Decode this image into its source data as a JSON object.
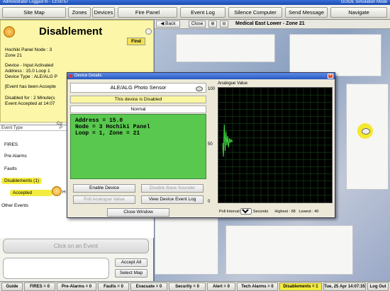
{
  "titlebar": {
    "left": "Administrator Logged In - 13:50:57",
    "right": "GUIDE Simulation Mode"
  },
  "topbar": {
    "buttons": [
      "Site Map",
      "Zones",
      "Devices",
      "Fire Panel",
      "Event Log",
      "Silence Computer",
      "Send Message",
      "Navigate"
    ]
  },
  "event": {
    "title": "Disablement",
    "find": "Find",
    "lines": [
      "Hochiki Panel  Node : 3",
      "Zone 21",
      "Device - Input Activated",
      "Address : 15.0  Loop 1",
      "Device Type : ALE/ALG P",
      "[Event has been Accepte",
      "Disabled for : 2 Minute(s",
      "Event Accepted at 14:07"
    ]
  },
  "tree": {
    "col_header": "Event Type",
    "col_header2": "P",
    "col_header_top": "Cu",
    "nodes": [
      "FIRES",
      "Pre Alarms",
      "Faults",
      "Disablements (1)",
      "Accepted",
      "Other Events"
    ],
    "accepted_suffix": "H"
  },
  "left_actions": {
    "click_event": "Click on an Event",
    "accept_all": "Accept All",
    "select_map": "Select Map"
  },
  "map": {
    "back": "Back",
    "close": "Close",
    "title": "Medical East Lower - Zone 21"
  },
  "dialog": {
    "title": "Device Details",
    "device_type": "ALE/ALG Photo Sensor",
    "disabled_msg": "This device is Disabled",
    "state": "Normal",
    "info": [
      "Address = 15.0",
      "Node = 3 Hochiki Panel",
      "Loop = 1, Zone = 21"
    ],
    "enable": "Enable Device",
    "disable_sounder": "Disable Base Sounder",
    "poll": "Poll Analogue Value",
    "view_log": "View Device Event Log",
    "close_window": "Close Window",
    "analogue_label": "Analogue Value",
    "y_ticks": [
      "100",
      "50",
      "0"
    ],
    "poll_interval_label": "Poll Interval",
    "poll_interval_value": "1",
    "seconds": "Seconds",
    "highest": "Highest : 68",
    "lowest": "Lowest : 40"
  },
  "chart_data": {
    "type": "line",
    "x": [
      0,
      1,
      2,
      3,
      4,
      5,
      6,
      7,
      8,
      9,
      10,
      11,
      12
    ],
    "values": [
      52,
      40,
      68,
      45,
      62,
      50,
      58,
      48,
      56,
      52,
      55,
      53,
      54
    ],
    "ylim": [
      0,
      100
    ]
  },
  "statusbar": {
    "cells": [
      "Guide",
      "FIRES = 0",
      "Pre-Alarms = 0",
      "Faults = 0",
      "Evacuate = 0",
      "Security = 0",
      "Alert = 0",
      "Tech Alarms = 0",
      "Disablements = 1",
      "Tue, 25 Apr 14:07:35",
      "Log Out"
    ]
  },
  "colors": {
    "accent_yellow": "#f4ec40",
    "device_green": "#59c84e",
    "title_blue": "#2858c0"
  }
}
